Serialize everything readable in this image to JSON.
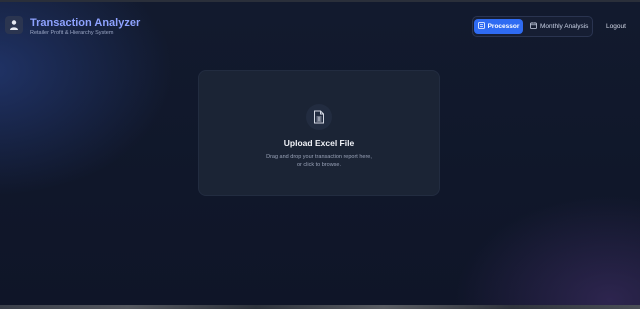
{
  "header": {
    "title": "Transaction Analyzer",
    "subtitle": "Retailer Profit & Hierarchy System",
    "logo_icon": "app-logo-icon"
  },
  "nav": {
    "tabs": [
      {
        "label": "Processor",
        "icon": "processor-icon",
        "active": true
      },
      {
        "label": "Monthly Analysis",
        "icon": "calendar-icon",
        "active": false
      }
    ],
    "logout_label": "Logout"
  },
  "upload": {
    "icon": "file-spreadsheet-icon",
    "title": "Upload Excel File",
    "description_line1": "Drag and drop your transaction report here,",
    "description_line2": "or click to browse."
  },
  "colors": {
    "accent": "#2f6bf2",
    "title": "#8ea2ff",
    "background": "#10172a",
    "card": "#1b2435"
  }
}
